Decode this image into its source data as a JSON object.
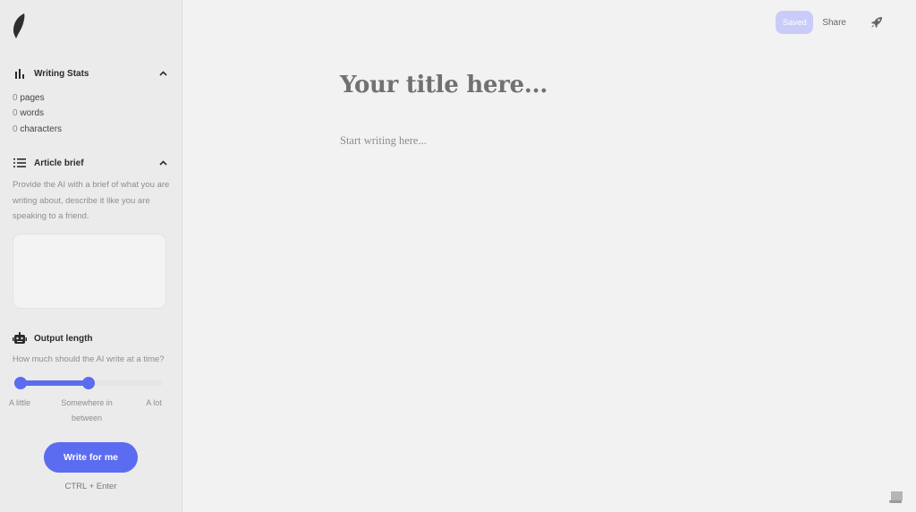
{
  "sidebar": {
    "logo_icon": "feather-icon",
    "writing_stats": {
      "title": "Writing Stats",
      "icon": "bar-chart-icon",
      "expanded": true,
      "stats": [
        {
          "value": "0",
          "label": "pages"
        },
        {
          "value": "0",
          "label": "words"
        },
        {
          "value": "0",
          "label": "characters"
        }
      ]
    },
    "article_brief": {
      "title": "Article brief",
      "icon": "list-icon",
      "expanded": true,
      "description": "Provide the AI with a brief of what you are writing about, describe it like you are speaking to a friend.",
      "input_value": "",
      "input_placeholder": ""
    },
    "output_length": {
      "title": "Output length",
      "icon": "robot-icon",
      "question": "How much should the AI write at a time?",
      "slider": {
        "min_label": "A little",
        "mid_label": "Somewhere in between",
        "max_label": "A lot",
        "value_fraction": 0.5
      }
    },
    "write_button": "Write for me",
    "shortcut": "CTRL + Enter"
  },
  "topbar": {
    "saved_label": "Saved",
    "share_label": "Share",
    "publish_icon": "rocket-icon"
  },
  "editor": {
    "title_placeholder": "Your title here...",
    "body_placeholder": "Start writing here..."
  },
  "colors": {
    "accent": "#5c6cf0",
    "saved_bg": "#c9ccf8"
  }
}
